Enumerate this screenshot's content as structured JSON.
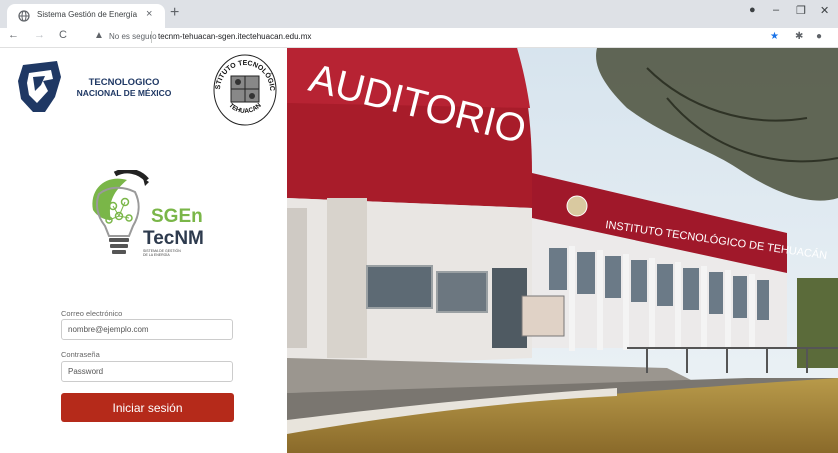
{
  "browser": {
    "tab_title": "Sistema Gestión de Energía",
    "tab_close": "×",
    "new_tab": "+",
    "security_label": "No es seguro",
    "url": "tecnm-tehuacan-sgen.itectehuacan.edu.mx",
    "nav": {
      "back": "←",
      "forward": "→",
      "reload": "C"
    },
    "window": {
      "minimize": "–",
      "maximize": "❐",
      "close": "✕"
    }
  },
  "branding": {
    "tecnm_line1": "TECNOLOGICO",
    "tecnm_line2": "NACIONAL DE MÉXICO",
    "seal_top": "INSTITUTO TECNOLÓGICO",
    "seal_bottom": "TEHUACAN",
    "sgen_name": "SGEn",
    "sgen_brand": "TecNM",
    "sgen_sub1": "SISTEMA DE GESTIÓN",
    "sgen_sub2": "DE LA ENERGÍA"
  },
  "form": {
    "email_label": "Correo electrónico",
    "email_placeholder": "nombre@ejemplo.com",
    "password_label": "Contraseña",
    "password_placeholder": "Password",
    "submit_label": "Iniciar sesión"
  },
  "photo": {
    "sign_top": "AUDITORIO",
    "sign_building": "INSTITUTO TECNOLÓGICO DE TEHUACÁN"
  },
  "colors": {
    "brand_red": "#b52a1a",
    "tecnm_navy": "#1f3864",
    "sgen_green": "#7ab648"
  }
}
